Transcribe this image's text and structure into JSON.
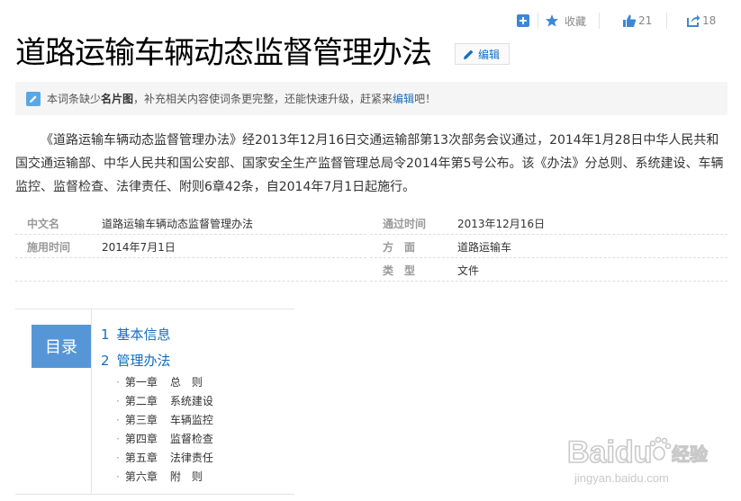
{
  "toolbar": {
    "collect_label": "收藏",
    "like_count": "21",
    "share_count": "18"
  },
  "title": "道路运输车辆动态监督管理办法",
  "edit_label": "编辑",
  "notice": {
    "prefix": "本词条缺少",
    "missing": "名片图",
    "middle": "，补充相关内容使词条更完整，还能快速升级，赶紧来",
    "link": "编辑",
    "suffix": "吧！"
  },
  "intro": "《道路运输车辆动态监督管理办法》经2013年12月16日交通运输部第13次部务会议通过，2014年1月28日中华人民共和国交通运输部、中华人民共和国公安部、国家安全生产监督管理总局令2014年第5号公布。该《办法》分总则、系统建设、车辆监控、监督检查、法律责任、附则6章42条，自2014年7月1日起施行。",
  "basic_info": {
    "left": [
      {
        "name": "中文名",
        "value": "道路运输车辆动态监督管理办法"
      },
      {
        "name": "施用时间",
        "value": "2014年7月1日"
      }
    ],
    "right": [
      {
        "name": "通过时间",
        "value": "2013年12月16日"
      },
      {
        "name": "方　面",
        "value": "道路运输车"
      },
      {
        "name": "类　型",
        "value": "文件"
      }
    ]
  },
  "catalog": {
    "label": "目录",
    "sections": [
      {
        "num": "1",
        "title": "基本信息"
      },
      {
        "num": "2",
        "title": "管理办法"
      }
    ],
    "chapters": [
      {
        "chapter": "第一章",
        "name": "总　则"
      },
      {
        "chapter": "第二章",
        "name": "系统建设"
      },
      {
        "chapter": "第三章",
        "name": "车辆监控"
      },
      {
        "chapter": "第四章",
        "name": "监督检查"
      },
      {
        "chapter": "第五章",
        "name": "法律责任"
      },
      {
        "chapter": "第六章",
        "name": "附　则"
      }
    ]
  },
  "watermark": {
    "brand": "Baidu",
    "brand_cn": "经验",
    "url": "jingyan.baidu.com"
  },
  "colors": {
    "accent": "#136ec2",
    "catalog_box": "#5796d6",
    "icon_blue": "#3d87d6"
  }
}
